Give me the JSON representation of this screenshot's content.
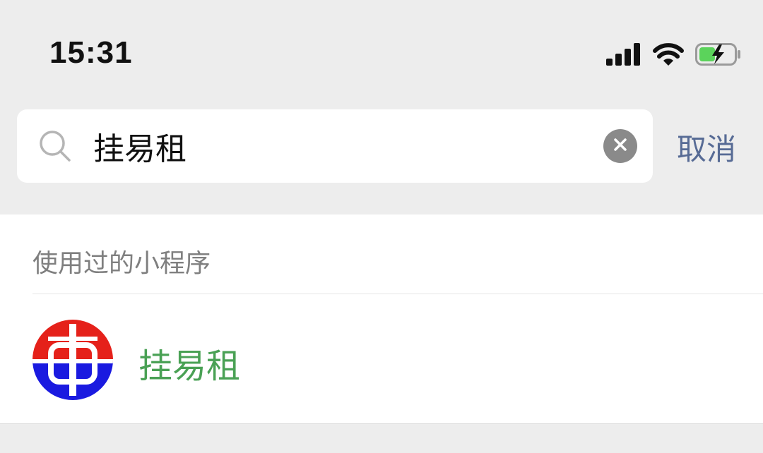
{
  "status_bar": {
    "time": "15:31",
    "icons": [
      "cellular-signal-icon",
      "wifi-icon",
      "battery-charging-icon"
    ]
  },
  "search": {
    "query": "挂易租",
    "cancel_label": "取消"
  },
  "results": {
    "section_title": "使用过的小程序",
    "items": [
      {
        "name": "挂易租",
        "icon": "app-logo-icon"
      }
    ]
  },
  "colors": {
    "background": "#ededed",
    "link": "#576b95",
    "app_name": "#4aa155",
    "battery_fill": "#5bd35b"
  }
}
